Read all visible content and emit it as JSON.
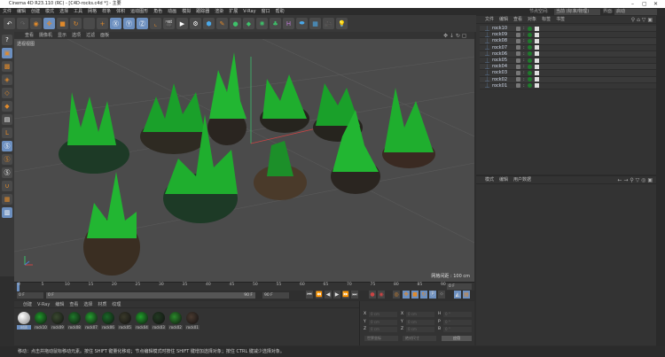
{
  "window": {
    "title": "Cinema 4D R23.110 (RC) - [C4D-rocks.c4d *] - 主要",
    "min": "–",
    "max": "▢",
    "close": "✕"
  },
  "menu": [
    "文件",
    "编辑",
    "创建",
    "模式",
    "选择",
    "工具",
    "网格",
    "样条",
    "体积",
    "运动图形",
    "角色",
    "动画",
    "模拟",
    "跟踪器",
    "渲染",
    "扩展",
    "V-Ray",
    "窗口",
    "帮助"
  ],
  "node_space": {
    "label": "节点空间:",
    "value": "当前 (标准/物理)",
    "layout_label": "界面:",
    "layout_value": "启动"
  },
  "viewport": {
    "menu": [
      "查看",
      "摄像机",
      "显示",
      "选项",
      "过滤",
      "面板"
    ],
    "label": "透视视图",
    "grid": "网格间距 : 100 cm"
  },
  "object_manager": {
    "menu": [
      "文件",
      "编辑",
      "查看",
      "对象",
      "标签",
      "书签"
    ],
    "objects": [
      "rock10",
      "rock09",
      "rock08",
      "rock07",
      "rock06",
      "rock05",
      "rock04",
      "rock03",
      "rock02",
      "rock01"
    ]
  },
  "attribute_manager": {
    "menu": [
      "模式",
      "编辑",
      "用户数据"
    ]
  },
  "timeline": {
    "ticks": [
      "0",
      "5",
      "10",
      "15",
      "20",
      "25",
      "30",
      "35",
      "40",
      "45",
      "50",
      "55",
      "60",
      "65",
      "70",
      "75",
      "80",
      "85",
      "90"
    ],
    "current": "0 F",
    "start": "0 F",
    "range_start": "0 F",
    "range_end": "90 F",
    "end": "90 F"
  },
  "material_manager": {
    "menu": [
      "创建",
      "V-Ray",
      "编辑",
      "查看",
      "选择",
      "材质",
      "纹理"
    ],
    "materials": [
      "材质",
      "rock10",
      "rock09",
      "rock08",
      "rock07",
      "rock06",
      "rock05",
      "rock04",
      "rock03",
      "rock02",
      "rock01"
    ]
  },
  "coordinates": {
    "rows": [
      [
        "X",
        "0 cm",
        "X",
        "0 cm",
        "H",
        "0 °"
      ],
      [
        "Y",
        "0 cm",
        "Y",
        "0 cm",
        "P",
        "0 °"
      ],
      [
        "Z",
        "0 cm",
        "Z",
        "0 cm",
        "B",
        "0 °"
      ]
    ],
    "mode": "世界坐标",
    "size": "绝对尺寸",
    "apply": "应用"
  },
  "status": "移动：点击并拖动鼠标移动元素。按住 SHIFT 键量化移动；节点编辑模式时按住 SHIFT 键增加选择对象；按住 CTRL 键减少选择对象。"
}
